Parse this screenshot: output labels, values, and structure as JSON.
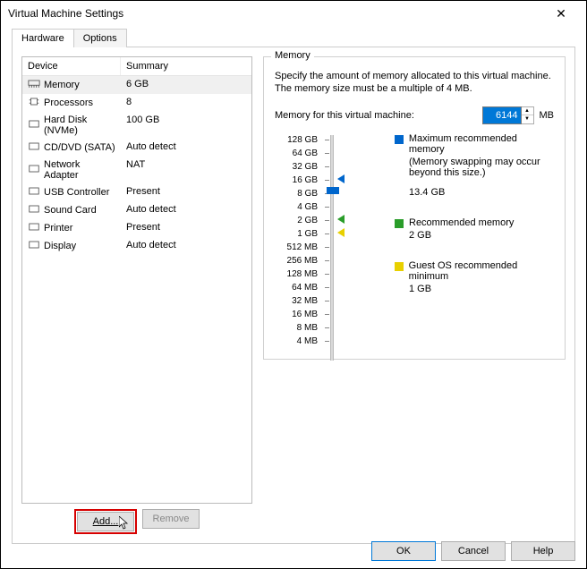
{
  "window": {
    "title": "Virtual Machine Settings"
  },
  "tabs": {
    "hardware": "Hardware",
    "options": "Options"
  },
  "device_list": {
    "headers": {
      "device": "Device",
      "summary": "Summary"
    },
    "rows": [
      {
        "name": "Memory",
        "summary": "6 GB",
        "selected": true
      },
      {
        "name": "Processors",
        "summary": "8"
      },
      {
        "name": "Hard Disk (NVMe)",
        "summary": "100 GB"
      },
      {
        "name": "CD/DVD (SATA)",
        "summary": "Auto detect"
      },
      {
        "name": "Network Adapter",
        "summary": "NAT"
      },
      {
        "name": "USB Controller",
        "summary": "Present"
      },
      {
        "name": "Sound Card",
        "summary": "Auto detect"
      },
      {
        "name": "Printer",
        "summary": "Present"
      },
      {
        "name": "Display",
        "summary": "Auto detect"
      }
    ]
  },
  "buttons": {
    "add": "Add...",
    "remove": "Remove",
    "ok": "OK",
    "cancel": "Cancel",
    "help": "Help"
  },
  "memory": {
    "group_label": "Memory",
    "description": "Specify the amount of memory allocated to this virtual machine. The memory size must be a multiple of 4 MB.",
    "field_label": "Memory for this virtual machine:",
    "value": "6144",
    "unit": "MB",
    "ticks": [
      "128 GB",
      "64 GB",
      "32 GB",
      "16 GB",
      "8 GB",
      "4 GB",
      "2 GB",
      "1 GB",
      "512 MB",
      "256 MB",
      "128 MB",
      "64 MB",
      "32 MB",
      "16 MB",
      "8 MB",
      "4 MB"
    ],
    "legend": {
      "max": {
        "label": "Maximum recommended memory",
        "note": "(Memory swapping may occur beyond this size.)",
        "value": "13.4 GB"
      },
      "rec": {
        "label": "Recommended memory",
        "value": "2 GB"
      },
      "min": {
        "label": "Guest OS recommended minimum",
        "value": "1 GB"
      }
    }
  }
}
